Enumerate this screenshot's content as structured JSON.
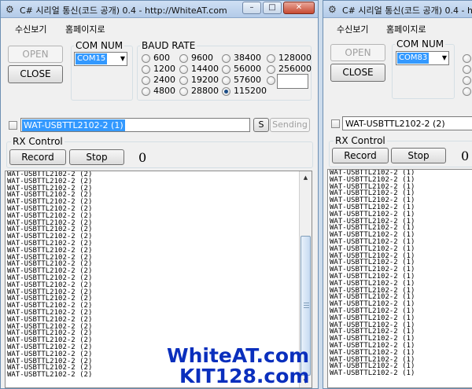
{
  "window_left": {
    "title": "C# 시리얼 통신(코드 공개) 0.4 - http://WhiteAT.com",
    "menus": [
      "수신보기",
      "홈페이지로"
    ],
    "open_label": "OPEN",
    "close_label": "CLOSE",
    "com_num_label": "COM NUM",
    "com_value": "COM15",
    "baud_label": "BAUD RATE",
    "baud_rates": [
      "600",
      "1200",
      "2400",
      "4800",
      "9600",
      "14400",
      "19200",
      "28800",
      "38400",
      "56000",
      "57600",
      "115200",
      "128000",
      "256000"
    ],
    "selected_baud": "115200",
    "send_text": "WAT-USBTTL2102-2 (1)",
    "s_label": "S",
    "sending_label": "Sending",
    "rx_control_label": "RX Control",
    "record_label": "Record",
    "stop_label": "Stop",
    "counter": "0",
    "rx_lines": [
      "WAT-USBTTL2102-2 (2)",
      "WAT-USBTTL2102-2 (2)",
      "WAT-USBTTL2102-2 (2)",
      "WAT-USBTTL2102-2 (2)",
      "WAT-USBTTL2102-2 (2)",
      "WAT-USBTTL2102-2 (2)",
      "WAT-USBTTL2102-2 (2)",
      "WAT-USBTTL2102-2 (2)",
      "WAT-USBTTL2102-2 (2)",
      "WAT-USBTTL2102-2 (2)",
      "WAT-USBTTL2102-2 (2)",
      "WAT-USBTTL2102-2 (2)",
      "WAT-USBTTL2102-2 (2)",
      "WAT-USBTTL2102-2 (2)",
      "WAT-USBTTL2102-2 (2)",
      "WAT-USBTTL2102-2 (2)",
      "WAT-USBTTL2102-2 (2)",
      "WAT-USBTTL2102-2 (2)",
      "WAT-USBTTL2102-2 (2)",
      "WAT-USBTTL2102-2 (2)",
      "WAT-USBTTL2102-2 (2)",
      "WAT-USBTTL2102-2 (2)",
      "WAT-USBTTL2102-2 (2)",
      "WAT-USBTTL2102-2 (2)",
      "WAT-USBTTL2102-2 (2)",
      "WAT-USBTTL2102-2 (2)",
      "WAT-USBTTL2102-2 (2)",
      "WAT-USBTTL2102-2 (2)",
      "WAT-USBTTL2102-2 (2)",
      "WAT-USBTTL2102-2 (2)"
    ]
  },
  "window_right": {
    "title": "C# 시리얼 통신(코드 공개) 0.4 - h",
    "menus": [
      "수신보기",
      "홈페이지로"
    ],
    "open_label": "OPEN",
    "close_label": "CLOSE",
    "com_num_label": "COM NUM",
    "com_value": "COM83",
    "send_text": "WAT-USBTTL2102-2 (2)",
    "rx_control_label": "RX Control",
    "record_label": "Record",
    "stop_label": "Stop",
    "counter": "0",
    "rx_lines": [
      "WAT-USBTTL2102-2 (1)",
      "WAT-USBTTL2102-2 (1)",
      "WAT-USBTTL2102-2 (1)",
      "WAT-USBTTL2102-2 (1)",
      "WAT-USBTTL2102-2 (1)",
      "WAT-USBTTL2102-2 (1)",
      "WAT-USBTTL2102-2 (1)",
      "WAT-USBTTL2102-2 (1)",
      "WAT-USBTTL2102-2 (1)",
      "WAT-USBTTL2102-2 (1)",
      "WAT-USBTTL2102-2 (1)",
      "WAT-USBTTL2102-2 (1)",
      "WAT-USBTTL2102-2 (1)",
      "WAT-USBTTL2102-2 (1)",
      "WAT-USBTTL2102-2 (1)",
      "WAT-USBTTL2102-2 (1)",
      "WAT-USBTTL2102-2 (1)",
      "WAT-USBTTL2102-2 (1)",
      "WAT-USBTTL2102-2 (1)",
      "WAT-USBTTL2102-2 (1)",
      "WAT-USBTTL2102-2 (1)",
      "WAT-USBTTL2102-2 (1)",
      "WAT-USBTTL2102-2 (1)",
      "WAT-USBTTL2102-2 (1)",
      "WAT-USBTTL2102-2 (1)",
      "WAT-USBTTL2102-2 (1)",
      "WAT-USBTTL2102-2 (1)",
      "WAT-USBTTL2102-2 (1)",
      "WAT-USBTTL2102-2 (1)",
      "WAT-USBTTL2102-2 (1)"
    ]
  },
  "watermark": [
    "WhiteAT.com",
    "KIT128.com"
  ],
  "colors": {
    "watermark": "#0a2fbd",
    "selection": "#3399ff",
    "titlebar": "#b3cbe8"
  }
}
